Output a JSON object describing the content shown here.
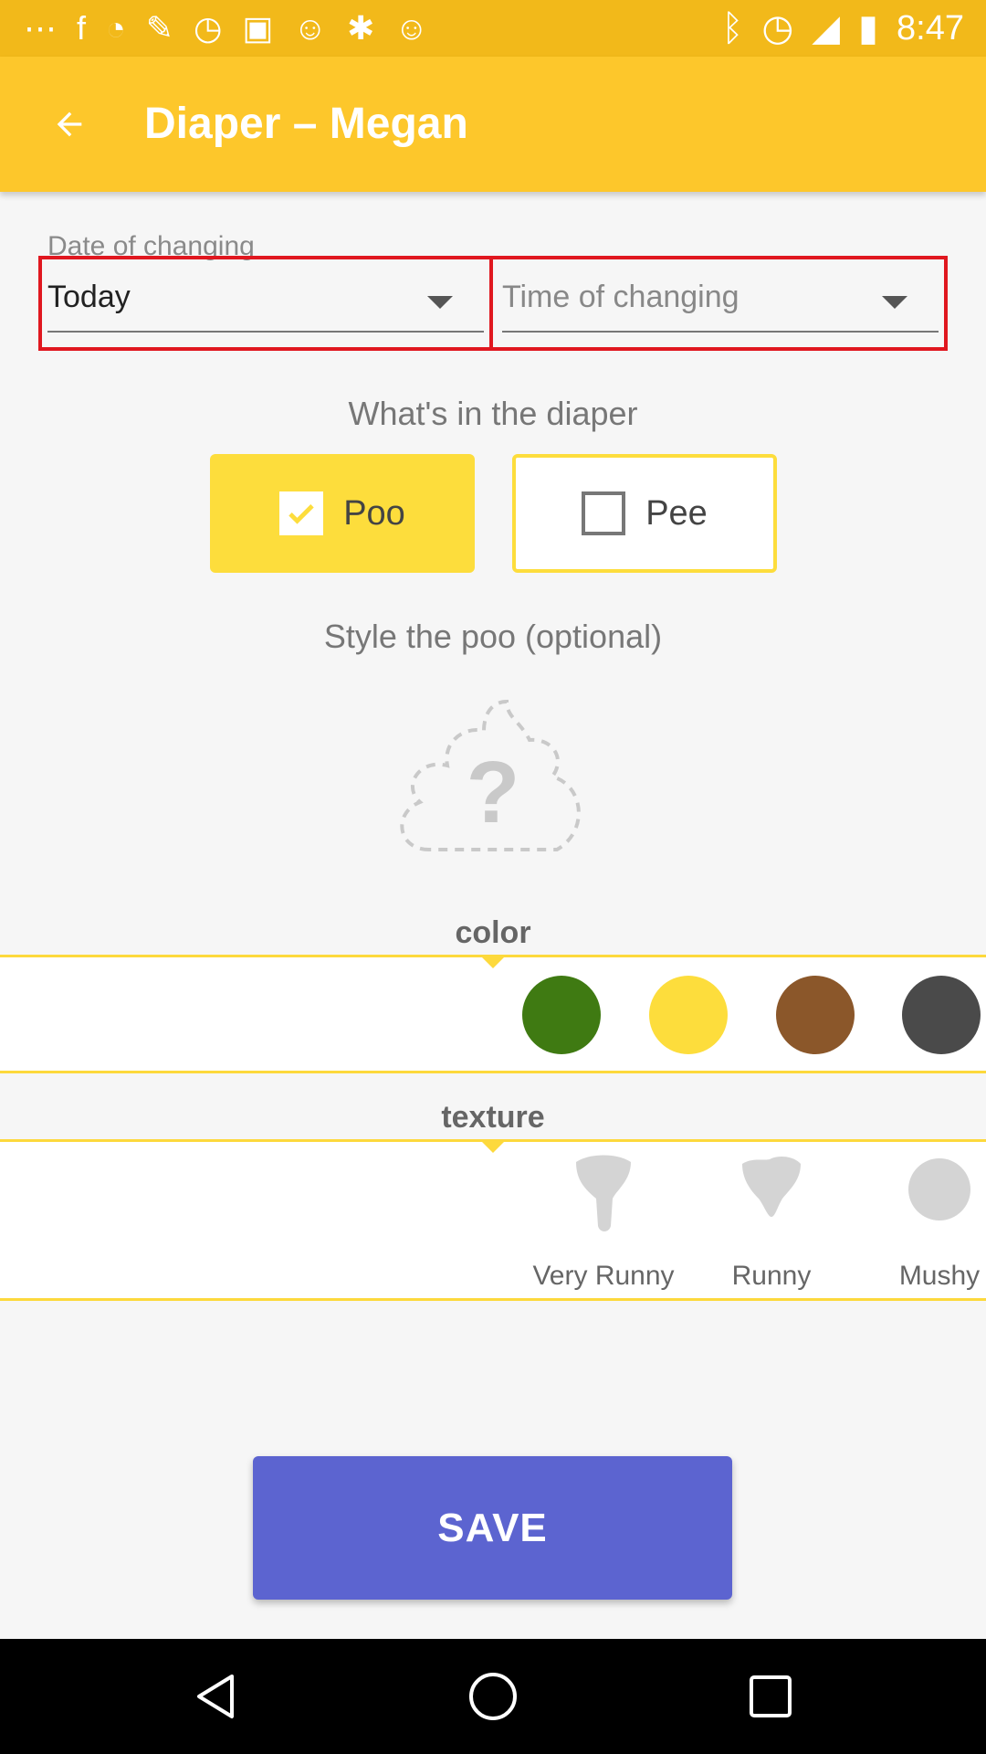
{
  "status_bar": {
    "time": "8:47",
    "left_icons": [
      "more-icon",
      "facebook-icon",
      "timer-icon",
      "wrench-icon",
      "alarm-icon",
      "qr-icon",
      "smiley-icon",
      "translate-icon",
      "smiley-icon",
      "bluetooth-icon",
      "alarm-icon",
      "signal-icon",
      "battery-icon"
    ]
  },
  "app_bar": {
    "title": "Diaper – Megan"
  },
  "date": {
    "label": "Date of changing",
    "value": "Today",
    "time_placeholder": "Time of changing"
  },
  "contents": {
    "title": "What's in the diaper",
    "options": [
      {
        "label": "Poo",
        "checked": true
      },
      {
        "label": "Pee",
        "checked": false
      }
    ]
  },
  "style": {
    "title": "Style the poo (optional)",
    "placeholder_glyph": "?"
  },
  "color": {
    "label": "color",
    "swatches": [
      "#3f7a12",
      "#fddd3c",
      "#8b572a",
      "#4a4a4a"
    ]
  },
  "texture": {
    "label": "texture",
    "items": [
      "Very Runny",
      "Runny",
      "Mushy"
    ]
  },
  "save_label": "SAVE",
  "colors": {
    "app_bar": "#fdc72b",
    "accent_yellow": "#fddd3c",
    "save_button": "#5c64d0",
    "highlight": "#e0171f"
  }
}
